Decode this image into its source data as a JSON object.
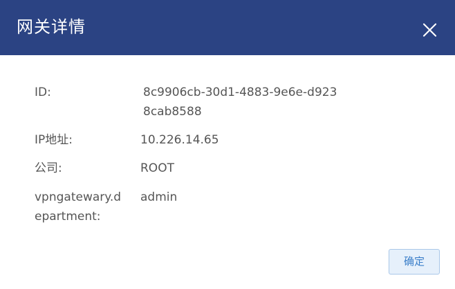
{
  "dialog": {
    "title": "网关详情",
    "close_icon": "close-icon",
    "header_color": "#2b4383"
  },
  "fields": {
    "id_label": "ID:",
    "id_value_line1": "8c9906cb-30d1-4883-9e6e-d923",
    "id_value_line2": "8cab8588",
    "ip_label": "IP地址:",
    "ip_value": "10.226.14.65",
    "company_label": "公司:",
    "company_value": "ROOT",
    "department_label_line1": "vpngatewary.d",
    "department_label_line2": "epartment:",
    "department_value": "admin"
  },
  "footer": {
    "confirm_label": "确定",
    "accent_color": "#3a7ec9"
  }
}
